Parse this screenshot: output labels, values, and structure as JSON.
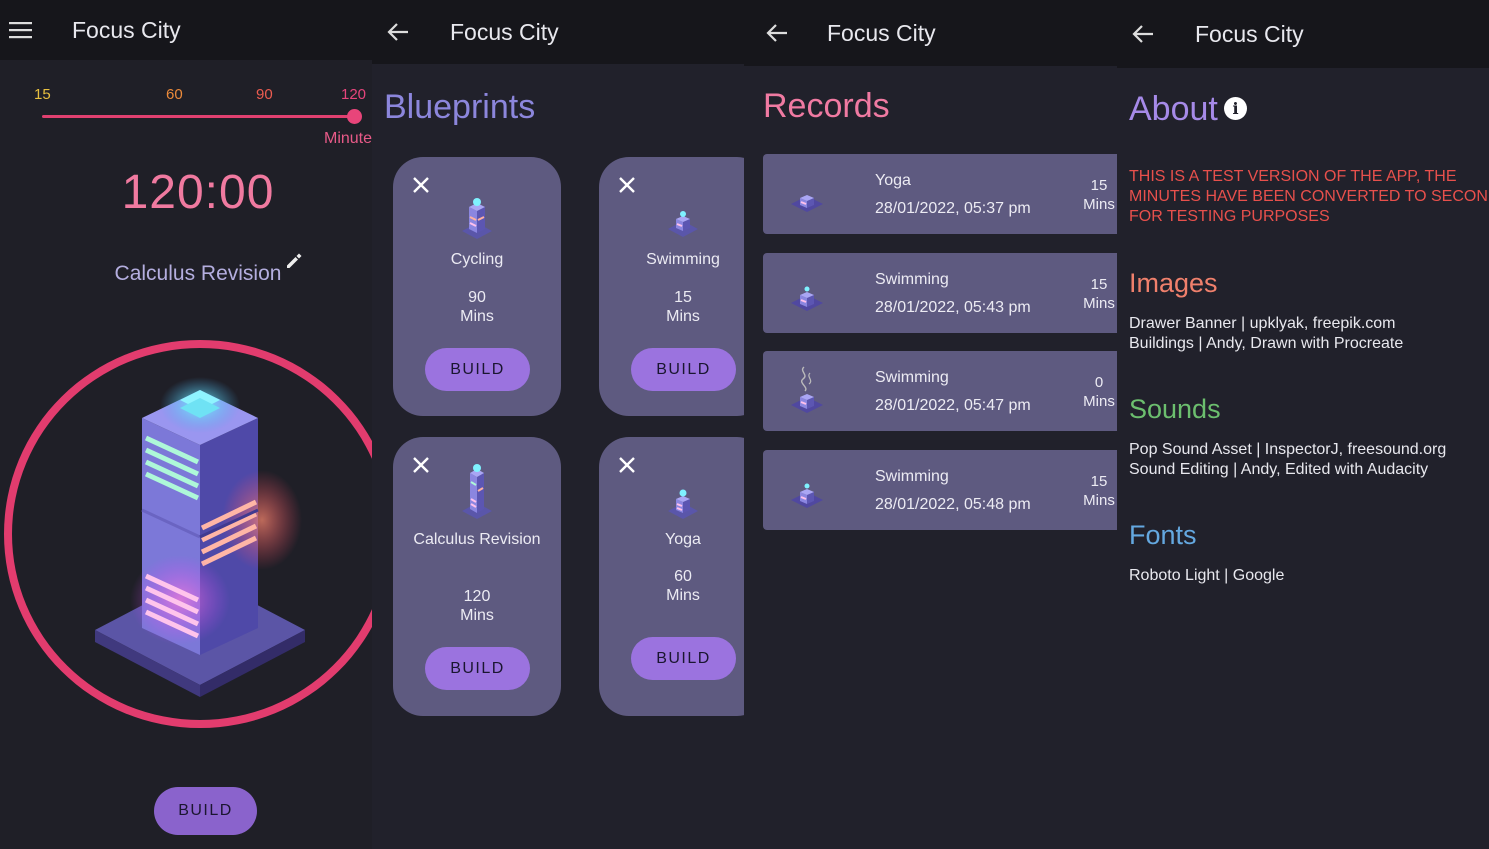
{
  "app": {
    "title": "Focus City"
  },
  "timer_screen": {
    "ticks": [
      "15",
      "60",
      "90",
      "120"
    ],
    "slider_unit": "Minutes",
    "slider_value_minutes": 120,
    "timer": "120:00",
    "task_name": "Calculus Revision",
    "build_label": "BUILD",
    "colors": {
      "ring": "#e23c6e",
      "accent": "#8a63cc"
    }
  },
  "blueprints_screen": {
    "heading": "Blueprints",
    "cards": [
      {
        "name": "Cycling",
        "minutes": "90",
        "unit": "Mins",
        "build_label": "BUILD"
      },
      {
        "name": "Swimming",
        "minutes": "15",
        "unit": "Mins",
        "build_label": "BUILD"
      },
      {
        "name": "Calculus Revision",
        "minutes": "120",
        "unit": "Mins",
        "build_label": "BUILD"
      },
      {
        "name": "Yoga",
        "minutes": "60",
        "unit": "Mins",
        "build_label": "BUILD"
      }
    ]
  },
  "records_screen": {
    "heading": "Records",
    "records": [
      {
        "activity": "Yoga",
        "date": "28/01/2022, 05:37 pm",
        "minutes": "15",
        "unit": "Mins"
      },
      {
        "activity": "Swimming",
        "date": "28/01/2022, 05:43 pm",
        "minutes": "15",
        "unit": "Mins"
      },
      {
        "activity": "Swimming",
        "date": "28/01/2022, 05:47 pm",
        "minutes": "0",
        "unit": "Mins"
      },
      {
        "activity": "Swimming",
        "date": "28/01/2022, 05:48 pm",
        "minutes": "15",
        "unit": "Mins"
      }
    ]
  },
  "about_screen": {
    "heading": "About",
    "warning_lines": [
      "THIS IS A TEST VERSION OF THE APP, THE",
      "MINUTES HAVE BEEN CONVERTED TO SECONDS",
      "FOR TESTING PURPOSES"
    ],
    "images": {
      "heading": "Images",
      "lines": [
        "Drawer Banner  |  upklyak, freepik.com",
        "Buildings  |  Andy, Drawn with Procreate"
      ]
    },
    "sounds": {
      "heading": "Sounds",
      "lines": [
        "Pop Sound Asset  |  InspectorJ, freesound.org",
        "Sound Editing  |  Andy, Edited with Audacity"
      ]
    },
    "fonts": {
      "heading": "Fonts",
      "lines": [
        "Roboto Light  |  Google"
      ]
    },
    "colors": {
      "about": "#a68ae8",
      "warning": "#e8504c",
      "images": "#f0806c",
      "sounds": "#6cbe6e",
      "fonts": "#64a8e0"
    }
  }
}
